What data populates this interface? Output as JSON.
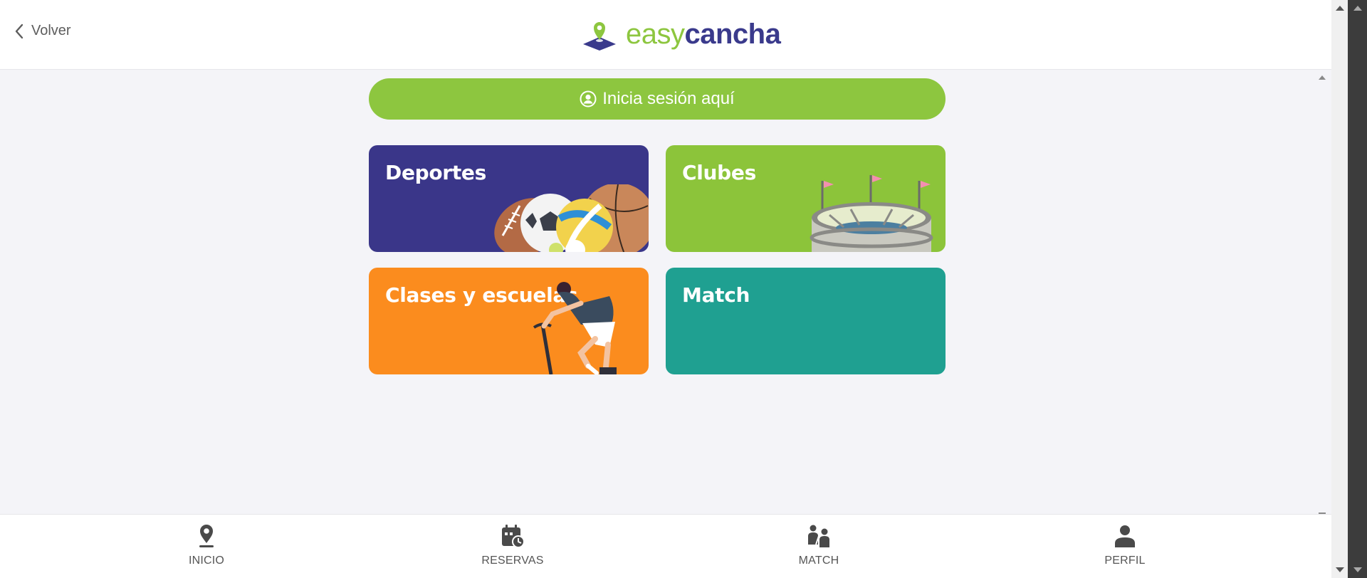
{
  "header": {
    "back_label": "Volver",
    "logo": {
      "part1": "easy",
      "part2": "cancha"
    }
  },
  "login": {
    "label": "Inicia sesión aquí",
    "icon": "user-circle-icon"
  },
  "cards": [
    {
      "title": "Deportes",
      "color": "#3a3689",
      "illustration": "sports-balls"
    },
    {
      "title": "Clubes",
      "color": "#8cc43a",
      "illustration": "stadium"
    },
    {
      "title": "Clases y escuelas",
      "color": "#fb8c1e",
      "illustration": "cyclist"
    },
    {
      "title": "Match",
      "color": "#1fa091",
      "illustration": "none"
    }
  ],
  "bottom_nav": [
    {
      "label": "INICIO",
      "icon": "location-pin-icon"
    },
    {
      "label": "RESERVAS",
      "icon": "calendar-clock-icon"
    },
    {
      "label": "MATCH",
      "icon": "match-players-icon"
    },
    {
      "label": "PERFIL",
      "icon": "user-icon"
    }
  ],
  "colors": {
    "brand_green": "#8dc63f",
    "brand_navy": "#3a3a8c"
  }
}
